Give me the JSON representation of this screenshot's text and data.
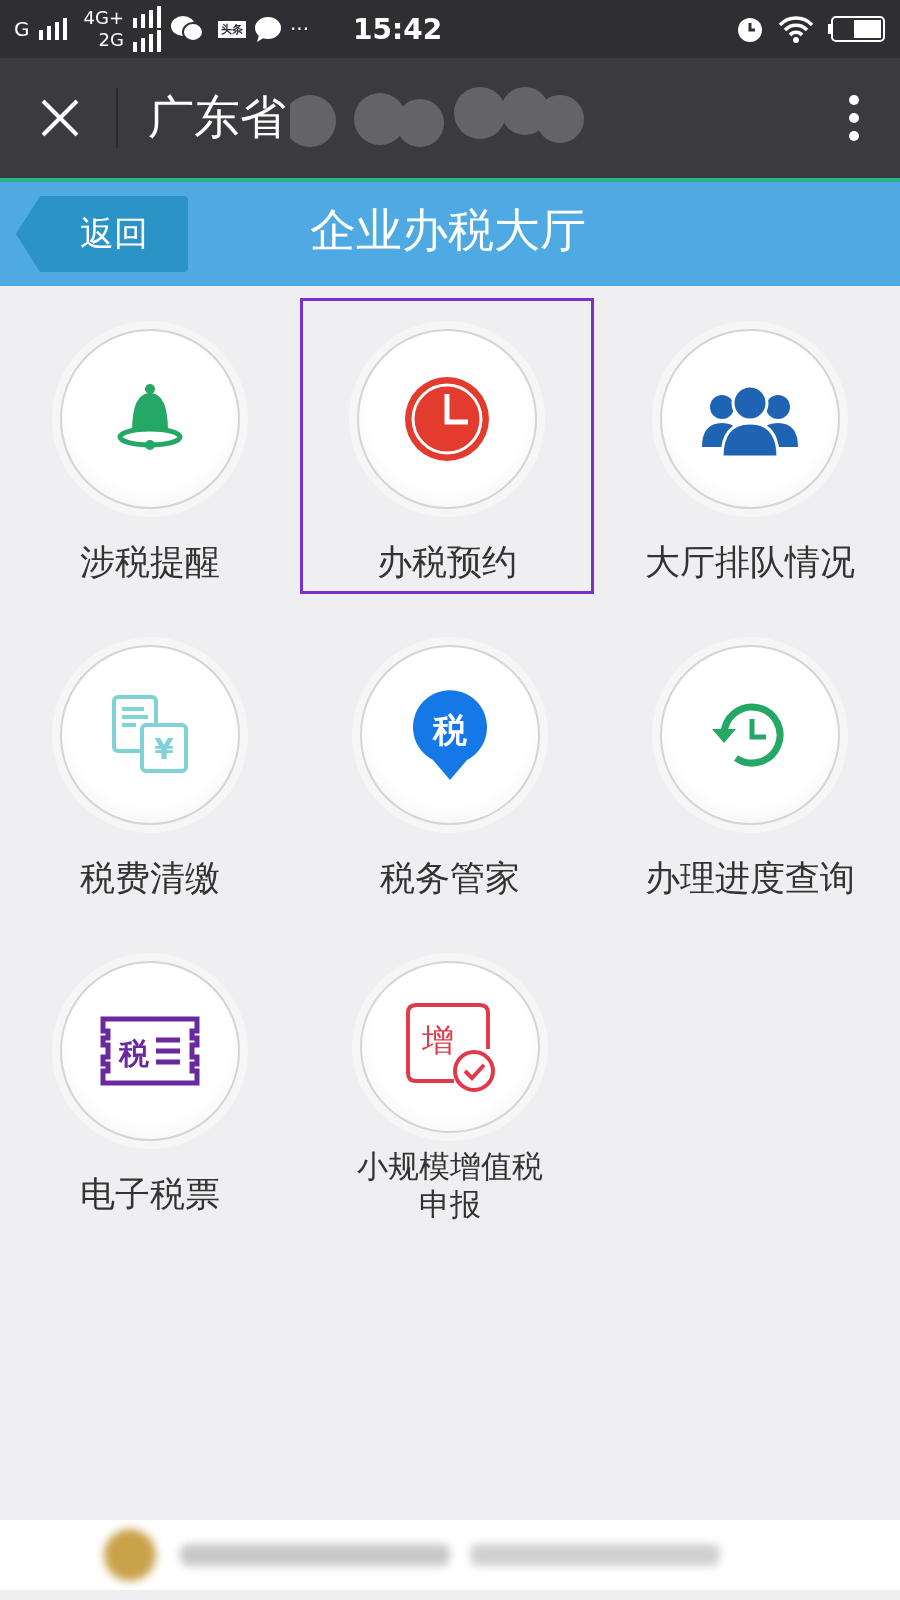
{
  "status_bar": {
    "network_1": "G",
    "network_2": "4G+",
    "network_3": "2G",
    "news_badge": "头条",
    "more": "···",
    "time": "15:42"
  },
  "title_bar": {
    "title": "广东省"
  },
  "header": {
    "back": "返回",
    "title": "企业办税大厅"
  },
  "tiles": [
    {
      "label": "涉税提醒",
      "kind": "bell",
      "selected": false
    },
    {
      "label": "办税预约",
      "kind": "clock",
      "selected": true
    },
    {
      "label": "大厅排队情况",
      "kind": "people",
      "selected": false
    },
    {
      "label": "税费清缴",
      "kind": "bills",
      "glyph": "¥",
      "selected": false
    },
    {
      "label": "税务管家",
      "kind": "pin",
      "glyph": "税",
      "selected": false
    },
    {
      "label": "办理进度查询",
      "kind": "history",
      "selected": false
    },
    {
      "label": "电子税票",
      "kind": "ticket",
      "glyph": "税",
      "selected": false
    },
    {
      "label": "小规模增值税申报",
      "kind": "vat",
      "glyph": "增",
      "selected": false
    }
  ]
}
